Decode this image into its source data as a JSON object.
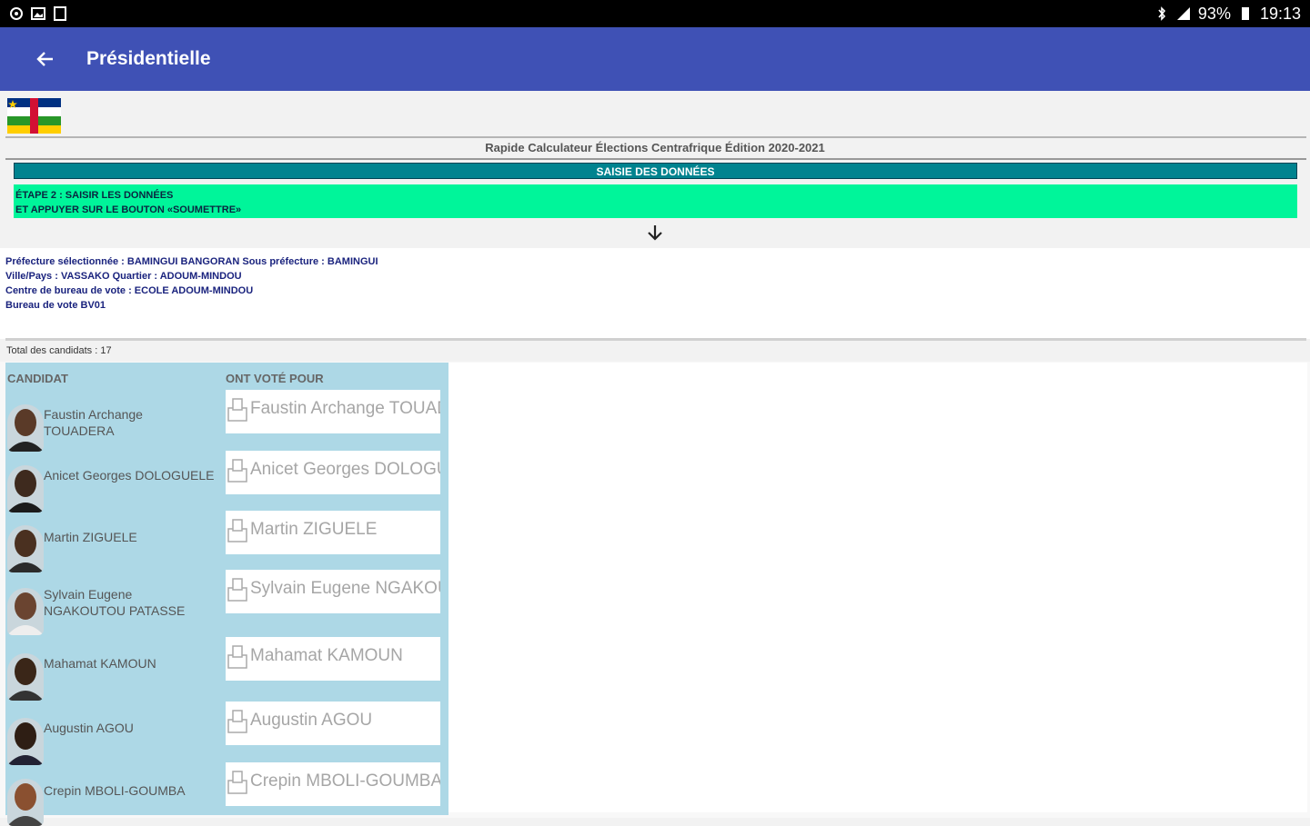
{
  "status": {
    "battery": "93%",
    "time": "19:13"
  },
  "appbar": {
    "title": "Présidentielle"
  },
  "calculator_title": "Rapide Calculateur Élections Centrafrique Édition 2020-2021",
  "section_header": "SAISIE DES DONNÉES",
  "instruction": {
    "line1": "ÉTAPE 2 : SAISIR LES DONNÉES",
    "line2": "ET APPUYER SUR LE BOUTON «SOUMETTRE»"
  },
  "location": {
    "line1": "Préfecture sélectionnée : BAMINGUI BANGORAN  Sous préfecture : BAMINGUI",
    "line2": "Ville/Pays : VASSAKO  Quartier : ADOUM-MINDOU",
    "line3": "Centre de bureau de vote : ECOLE ADOUM-MINDOU",
    "line4": " Bureau de vote BV01"
  },
  "total_label": "Total des candidats : 17",
  "table": {
    "col_candidate": "CANDIDAT",
    "col_votes": "ONT VOTÉ POUR",
    "rows": [
      {
        "name": "Faustin Archange TOUADERA",
        "placeholder": "Faustin Archange TOUADERA"
      },
      {
        "name": "Anicet Georges DOLOGUELE",
        "placeholder": "Anicet Georges DOLOGUELE"
      },
      {
        "name": "Martin ZIGUELE",
        "placeholder": "Martin ZIGUELE"
      },
      {
        "name": "Sylvain Eugene NGAKOUTOU PATASSE",
        "placeholder": "Sylvain Eugene NGAKOUTOU PATASSE"
      },
      {
        "name": "Mahamat KAMOUN",
        "placeholder": "Mahamat KAMOUN"
      },
      {
        "name": "Augustin AGOU",
        "placeholder": "Augustin AGOU"
      },
      {
        "name": "Crepin MBOLI-GOUMBA",
        "placeholder": "Crepin MBOLI-GOUMBA"
      }
    ]
  },
  "colors": {
    "appbar": "#3f51b5",
    "section": "#00838f",
    "instruction": "#00f59a",
    "candidate_panel": "#add8e6"
  }
}
